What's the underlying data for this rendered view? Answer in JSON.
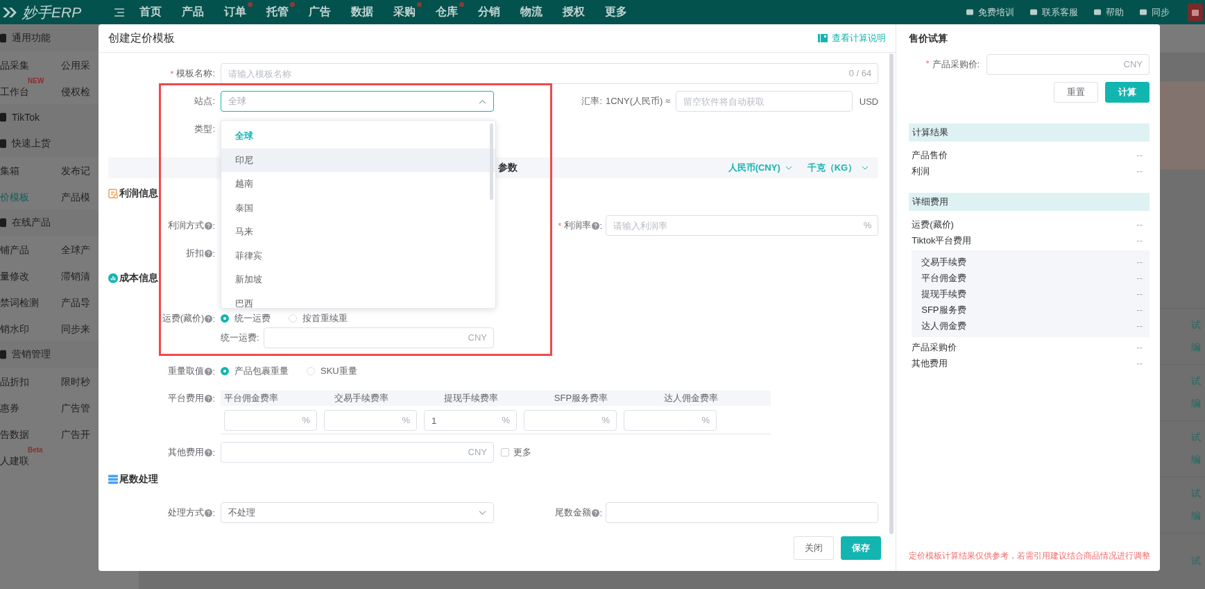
{
  "nav": {
    "logo": "妙手ERP",
    "items": [
      {
        "label": "首页",
        "dot": false
      },
      {
        "label": "产品",
        "dot": false
      },
      {
        "label": "订单",
        "dot": true
      },
      {
        "label": "托管",
        "dot": true
      },
      {
        "label": "广告",
        "dot": false
      },
      {
        "label": "数据",
        "dot": false
      },
      {
        "label": "采购",
        "dot": true
      },
      {
        "label": "仓库",
        "dot": true
      },
      {
        "label": "分销",
        "dot": false
      },
      {
        "label": "物流",
        "dot": false
      },
      {
        "label": "授权",
        "dot": false
      },
      {
        "label": "更多",
        "dot": false
      }
    ],
    "links": [
      "免费培训",
      "联系客服",
      "帮助",
      "同步"
    ]
  },
  "sidebar": {
    "rows": [
      {
        "kind": "header",
        "label": "通用功能"
      },
      {
        "kind": "pair",
        "left": {
          "label": "品采集",
          "selected": false
        },
        "right": {
          "label": "公用采",
          "selected": false
        }
      },
      {
        "kind": "pair",
        "left": {
          "label": "工作台",
          "selected": false,
          "badge": "NEW"
        },
        "right": {
          "label": "侵权检",
          "selected": false
        }
      },
      {
        "kind": "header",
        "label": "TikTok"
      },
      {
        "kind": "header",
        "label": "快速上货"
      },
      {
        "kind": "pair",
        "left": {
          "label": "集箱",
          "selected": false
        },
        "right": {
          "label": "发布记",
          "selected": false
        }
      },
      {
        "kind": "pair",
        "left": {
          "label": "价模板",
          "selected": true
        },
        "right": {
          "label": "产品模",
          "selected": false
        }
      },
      {
        "kind": "header",
        "label": "在线产品"
      },
      {
        "kind": "pair",
        "left": {
          "label": "铺产品",
          "selected": false
        },
        "right": {
          "label": "全球产",
          "selected": false
        }
      },
      {
        "kind": "pair",
        "left": {
          "label": "量修改",
          "selected": false
        },
        "right": {
          "label": "滞销清",
          "selected": false
        }
      },
      {
        "kind": "pair",
        "left": {
          "label": "禁词检测",
          "selected": false
        },
        "right": {
          "label": "产品导",
          "selected": false
        }
      },
      {
        "kind": "pair",
        "left": {
          "label": "销水印",
          "selected": false
        },
        "right": {
          "label": "同步来",
          "selected": false
        }
      },
      {
        "kind": "header",
        "label": "营销管理"
      },
      {
        "kind": "pair",
        "left": {
          "label": "品折扣",
          "selected": false
        },
        "right": {
          "label": "限时秒",
          "selected": false
        }
      },
      {
        "kind": "pair",
        "left": {
          "label": "惠券",
          "selected": false
        },
        "right": {
          "label": "广告管",
          "selected": false
        }
      },
      {
        "kind": "pair",
        "left": {
          "label": "告数据",
          "selected": false
        },
        "right": {
          "label": "广告开",
          "selected": false
        }
      },
      {
        "kind": "pair",
        "left": {
          "label": "人建联",
          "selected": false,
          "badge": "Beta"
        }
      }
    ]
  },
  "list_actions": [
    [
      "试",
      "编"
    ],
    [
      "试",
      "编"
    ],
    [
      "试",
      "编"
    ],
    [
      "试",
      "编"
    ],
    [
      "试"
    ]
  ],
  "dialog": {
    "title": "创建定价模板",
    "help_link": "查看计算说明",
    "template_name": {
      "mark": "*",
      "label": "模板名称:",
      "placeholder": "请输入模板名称",
      "counter": "0 / 64"
    },
    "site": {
      "label": "站点:",
      "placeholder": "全球",
      "expanded": true,
      "options": [
        {
          "label": "全球",
          "selected": true,
          "highlighted": false
        },
        {
          "label": "印尼",
          "selected": false,
          "highlighted": true
        },
        {
          "label": "越南",
          "selected": false,
          "highlighted": false
        },
        {
          "label": "泰国",
          "selected": false,
          "highlighted": false
        },
        {
          "label": "马来",
          "selected": false,
          "highlighted": false
        },
        {
          "label": "菲律宾",
          "selected": false,
          "highlighted": false
        },
        {
          "label": "新加坡",
          "selected": false,
          "highlighted": false
        },
        {
          "label": "巴西",
          "selected": false,
          "highlighted": false
        }
      ]
    },
    "rate": {
      "label": "汇率:",
      "prefix": "1CNY(人民币) ≈",
      "placeholder": "留空软件将自动获取",
      "suffix": "USD"
    },
    "type": {
      "label": "类型:"
    },
    "param_bar": {
      "title": "参数",
      "currency": "人民币(CNY)",
      "unit": "千克（KG）"
    },
    "profit": {
      "title": "利润信息",
      "method": {
        "label": "利润方式",
        "colon": ":"
      },
      "rate": {
        "mark": "*",
        "label": "利润率",
        "colon": ":",
        "placeholder": "请输入利润率",
        "suffix": "%"
      },
      "discount": {
        "label": "折扣",
        "colon": ":"
      }
    },
    "cost": {
      "title": "成本信息",
      "shipping": {
        "label": "运费(藏价)",
        "colon": ":",
        "options": [
          {
            "label": "统一运费",
            "selected": true
          },
          {
            "label": "按首重续重",
            "selected": false
          }
        ]
      },
      "unified": {
        "label": "统一运费:",
        "suffix": "CNY"
      },
      "weight": {
        "label": "重量取值",
        "colon": ":",
        "options": [
          {
            "label": "产品包裹重量",
            "selected": true
          },
          {
            "label": "SKU重量",
            "selected": false
          }
        ]
      },
      "platform": {
        "label": "平台费用",
        "colon": ":",
        "columns": [
          {
            "header": "平台佣金费率",
            "suffix": "%"
          },
          {
            "header": "交易手续费率",
            "suffix": "%"
          },
          {
            "header": "提现手续费率",
            "value": "1",
            "suffix": "%"
          },
          {
            "header": "SFP服务费率",
            "suffix": "%"
          },
          {
            "header": "达人佣金费率",
            "suffix": "%"
          }
        ]
      },
      "other": {
        "label": "其他费用",
        "colon": ":",
        "suffix": "CNY",
        "more": {
          "label": "更多",
          "checked": false
        }
      }
    },
    "tail": {
      "title": "尾数处理",
      "method": {
        "label": "处理方式",
        "colon": ":",
        "value": "不处理"
      },
      "amount": {
        "label": "尾数金额",
        "colon": ":"
      }
    },
    "buttons": {
      "close": "关闭",
      "save": "保存"
    }
  },
  "calculator": {
    "title": "售价试算",
    "price": {
      "mark": "*",
      "label": "产品采购价:",
      "suffix": "CNY"
    },
    "reset": "重置",
    "calc": "计算",
    "groups": [
      {
        "title": "计算结果",
        "rows": [
          {
            "label": "产品售价",
            "value": "--"
          },
          {
            "label": "利润",
            "value": "--"
          }
        ]
      },
      {
        "title": "详细费用",
        "rows": [
          {
            "label": "运费(藏价)",
            "value": "--"
          },
          {
            "label": "Tiktok平台费用",
            "value": "--",
            "children": [
              {
                "label": "交易手续费",
                "value": "--"
              },
              {
                "label": "平台佣金费",
                "value": "--"
              },
              {
                "label": "提现手续费",
                "value": "--"
              },
              {
                "label": "SFP服务费",
                "value": "--"
              },
              {
                "label": "达人佣金费",
                "value": "--"
              }
            ]
          },
          {
            "label": "产品采购价",
            "value": "--"
          },
          {
            "label": "其他费用",
            "value": "--"
          }
        ]
      }
    ],
    "note": "定价模板计算结果仅供参考，若需引用建议结合商品情况进行调整"
  }
}
